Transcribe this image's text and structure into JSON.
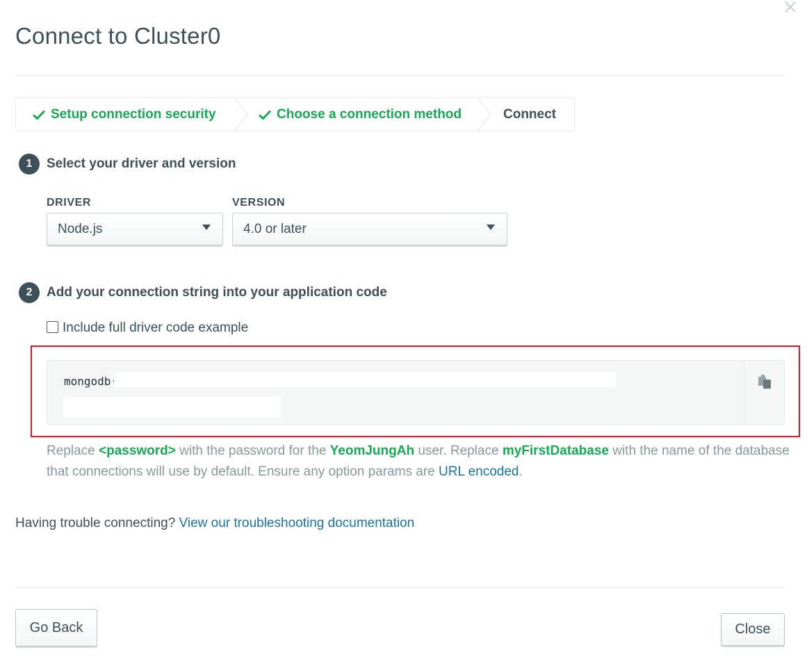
{
  "modal": {
    "title": "Connect to Cluster0"
  },
  "wizard": {
    "steps": [
      {
        "label": "Setup connection security",
        "status": "done"
      },
      {
        "label": "Choose a connection method",
        "status": "done"
      },
      {
        "label": "Connect",
        "status": "current"
      }
    ]
  },
  "step1": {
    "number": "1",
    "title": "Select your driver and version",
    "driver_label": "DRIVER",
    "driver_value": "Node.js",
    "version_label": "VERSION",
    "version_value": "4.0 or later"
  },
  "step2": {
    "number": "2",
    "title": "Add your connection string into your application code",
    "checkbox_label": "Include full driver code example",
    "checkbox_checked": false,
    "connection_string_visible": "mongodb·"
  },
  "help": {
    "t1": "Replace ",
    "password_token": "<password>",
    "t2": " with the password for the ",
    "user": "YeomJungAh",
    "t3": " user. Replace ",
    "db": "myFirstDatabase",
    "t4": " with the name of the database that connections will use by default. Ensure any option params are ",
    "link": "URL encoded",
    "t5": "."
  },
  "trouble": {
    "text": "Having trouble connecting? ",
    "link": "View our troubleshooting documentation"
  },
  "footer": {
    "back_label": "Go Back",
    "close_label": "Close"
  },
  "colors": {
    "accent_green": "#13aa52",
    "link_blue": "#1a73a6",
    "highlight_red": "#e4141e",
    "text_dark": "#3d4f58"
  }
}
